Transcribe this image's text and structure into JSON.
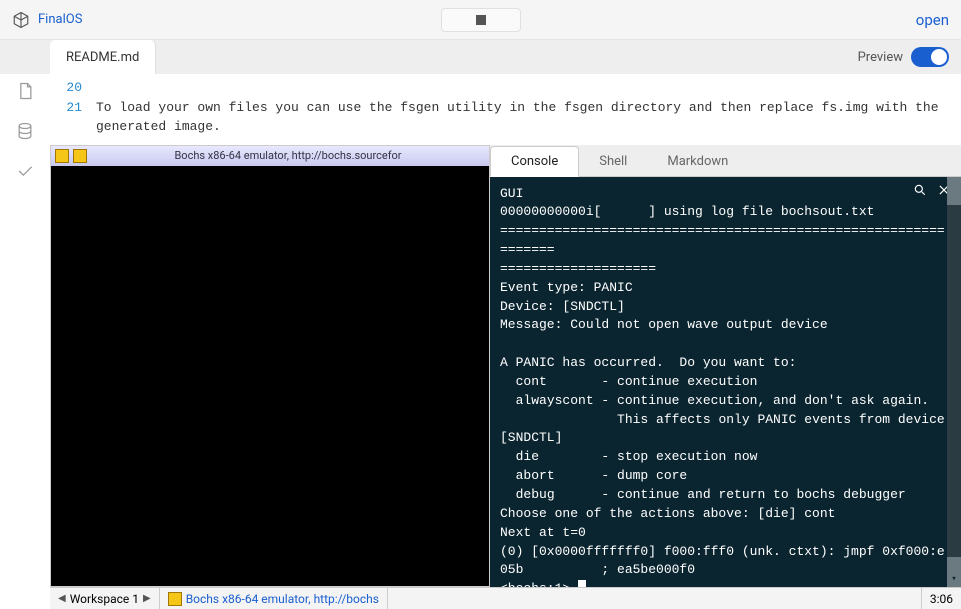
{
  "brand": {
    "name": "FinalOS"
  },
  "open_label": "open",
  "file_tab": "README.md",
  "preview_label": "Preview",
  "code": {
    "lines": [
      {
        "no": "20",
        "text": ""
      },
      {
        "no": "21",
        "text": "To load your own files you can use the fsgen utility in the fsgen directory and then replace fs.img with the generated image."
      }
    ]
  },
  "emu": {
    "title": "Bochs x86-64 emulator, http://bochs.sourcefor"
  },
  "console_tabs": {
    "console": "Console",
    "shell": "Shell",
    "markdown": "Markdown"
  },
  "console_text": "GUI\n00000000000i[      ] using log file bochsout.txt\n================================================================\n====================\nEvent type: PANIC\nDevice: [SNDCTL]\nMessage: Could not open wave output device\n\nA PANIC has occurred.  Do you want to:\n  cont       - continue execution\n  alwayscont - continue execution, and don't ask again.\n               This affects only PANIC events from device [SNDCTL]\n  die        - stop execution now\n  abort      - dump core\n  debug      - continue and return to bochs debugger\nChoose one of the actions above: [die] cont\nNext at t=0\n(0) [0x0000fffffff0] f000:fff0 (unk. ctxt): jmpf 0xf000:e05b          ; ea5be000f0\n<bochs:1> ",
  "taskbar": {
    "workspace": "Workspace 1",
    "window": "Bochs x86-64 emulator, http://bochs",
    "time": "3:06"
  }
}
